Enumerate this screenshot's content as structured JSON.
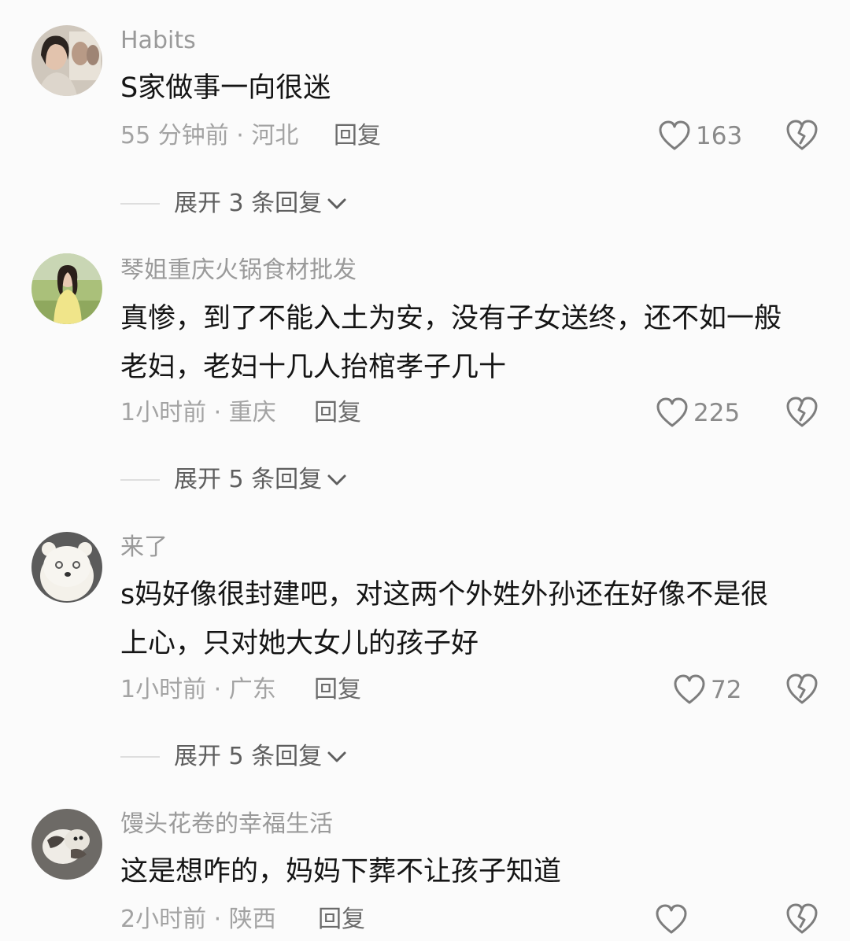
{
  "comments": [
    {
      "username": "Habits",
      "lines": [
        "S家做事一向很迷"
      ],
      "time": "55 分钟前 · 河北",
      "reply": "回复",
      "likes": "163",
      "expand": "展开 3 条回复"
    },
    {
      "username": "琴姐重庆火锅食材批发",
      "lines": [
        "真惨，到了不能入土为安，没有子女送终，还不如一般",
        "老妇，老妇十几人抬棺孝子几十"
      ],
      "time": "1小时前 · 重庆",
      "reply": "回复",
      "likes": "225",
      "expand": "展开 5 条回复"
    },
    {
      "username": "来了",
      "lines": [
        "s妈好像很封建吧，对这两个外姓外孙还在好像不是很",
        "上心，只对她大女儿的孩子好"
      ],
      "time": "1小时前 · 广东",
      "reply": "回复",
      "likes": "72",
      "expand": "展开 5 条回复"
    },
    {
      "username": "馒头花卷的幸福生活",
      "lines": [
        "这是想咋的，妈妈下葬不让孩子知道"
      ],
      "time": "2小时前 · 陕西",
      "reply": "回复",
      "likes": ""
    }
  ],
  "icons": {
    "like": "heart-outline-icon",
    "dislike": "broken-heart-icon",
    "expand": "chevron-down-icon"
  },
  "colors": {
    "background": "#fbfbfb",
    "username": "#9a9a9a",
    "text": "#151515",
    "meta": "#a3a3a3"
  }
}
